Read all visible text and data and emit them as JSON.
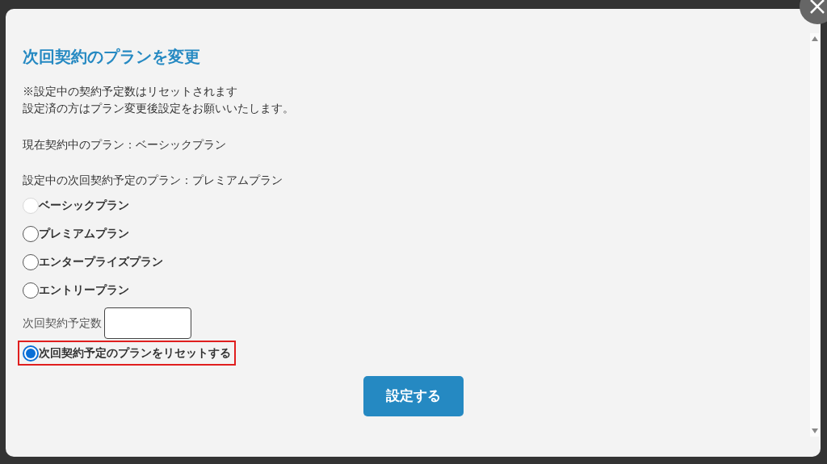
{
  "dialog": {
    "title": "次回契約のプランを変更",
    "notes": [
      "※設定中の契約予定数はリセットされます",
      "設定済の方はプラン変更後設定をお願いいたします。"
    ],
    "current_plan": "現在契約中のプラン：ベーシックプラン",
    "scheduled_plan": "設定中の次回契約予定のプラン：プレミアムプラン",
    "plans": [
      {
        "label": "ベーシックプラン",
        "selected": false,
        "disabled": true
      },
      {
        "label": "プレミアムプラン",
        "selected": false,
        "disabled": false
      },
      {
        "label": "エンタープライズプラン",
        "selected": false,
        "disabled": false
      },
      {
        "label": "エントリープラン",
        "selected": false,
        "disabled": false
      }
    ],
    "count_field": {
      "label": "次回契約予定数"
    },
    "reset_option": {
      "label": "次回契約予定のプランをリセットする",
      "selected": true,
      "highlighted": true
    },
    "submit": "設定する"
  }
}
